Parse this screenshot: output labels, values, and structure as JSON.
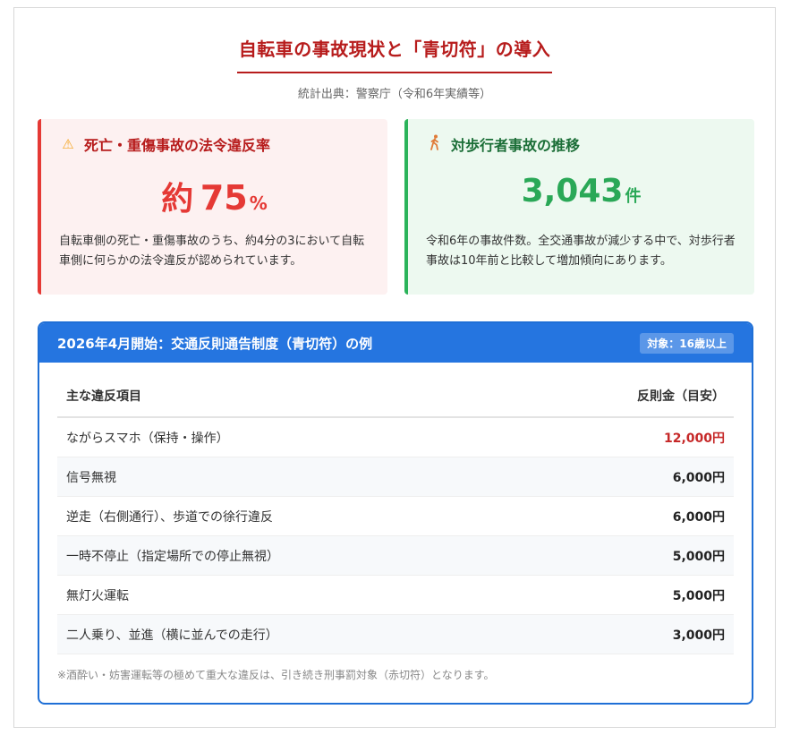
{
  "page": {
    "title": "自転車の事故現状と「青切符」の導入",
    "source": "統計出典：警察庁（令和6年実績等）"
  },
  "cards": {
    "violation": {
      "icon": "warning-icon",
      "title": "死亡・重傷事故の法令違反率",
      "value_prefix": "約",
      "value": "75",
      "unit": "%",
      "text": "自転車側の死亡・重傷事故のうち、約4分の3において自転車側に何らかの法令違反が認められています。",
      "accent_color": "#e53935"
    },
    "pedestrian": {
      "icon": "walking-person-icon",
      "title": "対歩行者事故の推移",
      "value": "3,043",
      "unit": "件",
      "text": "令和6年の事故件数。全交通事故が減少する中で、対歩行者事故は10年前と比較して増加傾向にあります。",
      "accent_color": "#2aa857"
    }
  },
  "table": {
    "title": "2026年4月開始：交通反則通告制度（青切符）の例",
    "badge": "対象：16歳以上",
    "header": {
      "item": "主な違反項目",
      "fine": "反則金（目安）"
    },
    "rows": [
      {
        "item": "ながらスマホ（保持・操作）",
        "fine": "12,000円",
        "highlight": true
      },
      {
        "item": "信号無視",
        "fine": "6,000円",
        "highlight": false
      },
      {
        "item": "逆走（右側通行）、歩道での徐行違反",
        "fine": "6,000円",
        "highlight": false
      },
      {
        "item": "一時不停止（指定場所での停止無視）",
        "fine": "5,000円",
        "highlight": false
      },
      {
        "item": "無灯火運転",
        "fine": "5,000円",
        "highlight": false
      },
      {
        "item": "二人乗り、並進（横に並んでの走行）",
        "fine": "3,000円",
        "highlight": false
      }
    ],
    "note": "※酒酔い・妨害運転等の極めて重大な違反は、引き続き刑事罰対象（赤切符）となります。",
    "accent_color": "#2575e0"
  }
}
